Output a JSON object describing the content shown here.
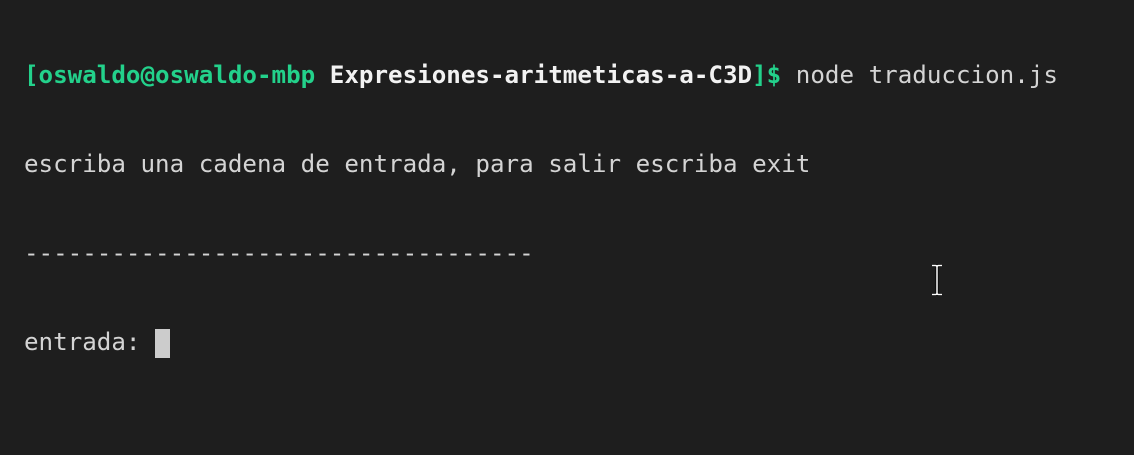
{
  "prompt": {
    "open": "[oswaldo@oswaldo-mbp",
    "dir": " Expresiones-aritmeticas-a-C3D",
    "close": "]$",
    "command": " node traduccion.js"
  },
  "output": {
    "line1": "escriba una cadena de entrada, para salir escriba exit",
    "separator": "-----------------------------------",
    "input_label": "entrada: "
  },
  "colors": {
    "background": "#1e1e1e",
    "prompt": "#23d18b",
    "text": "#d4d4d4"
  }
}
